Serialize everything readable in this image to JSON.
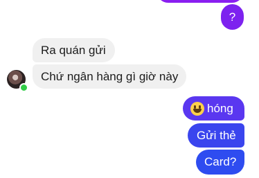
{
  "conversation": {
    "outgoing_top": {
      "text": ""
    },
    "outgoing_q": {
      "text": "?"
    },
    "incoming": [
      {
        "text": "Ra quán gửi"
      },
      {
        "text": "Chứ ngân hàng gì giờ này"
      }
    ],
    "outgoing": [
      {
        "emoji": "grinning-face-icon",
        "text": "hóng"
      },
      {
        "text": "Gửi thẻ"
      },
      {
        "text": "Card?"
      }
    ]
  },
  "colors": {
    "bubble_top": "#8a1ef0",
    "bubble_q": "#7d22ef",
    "bubble_hong": "#5a37f0",
    "bubble_gui": "#3a45ee",
    "bubble_card": "#2e4cf0",
    "incoming_bubble": "#f0f0f0",
    "online_dot": "#31cc46"
  }
}
